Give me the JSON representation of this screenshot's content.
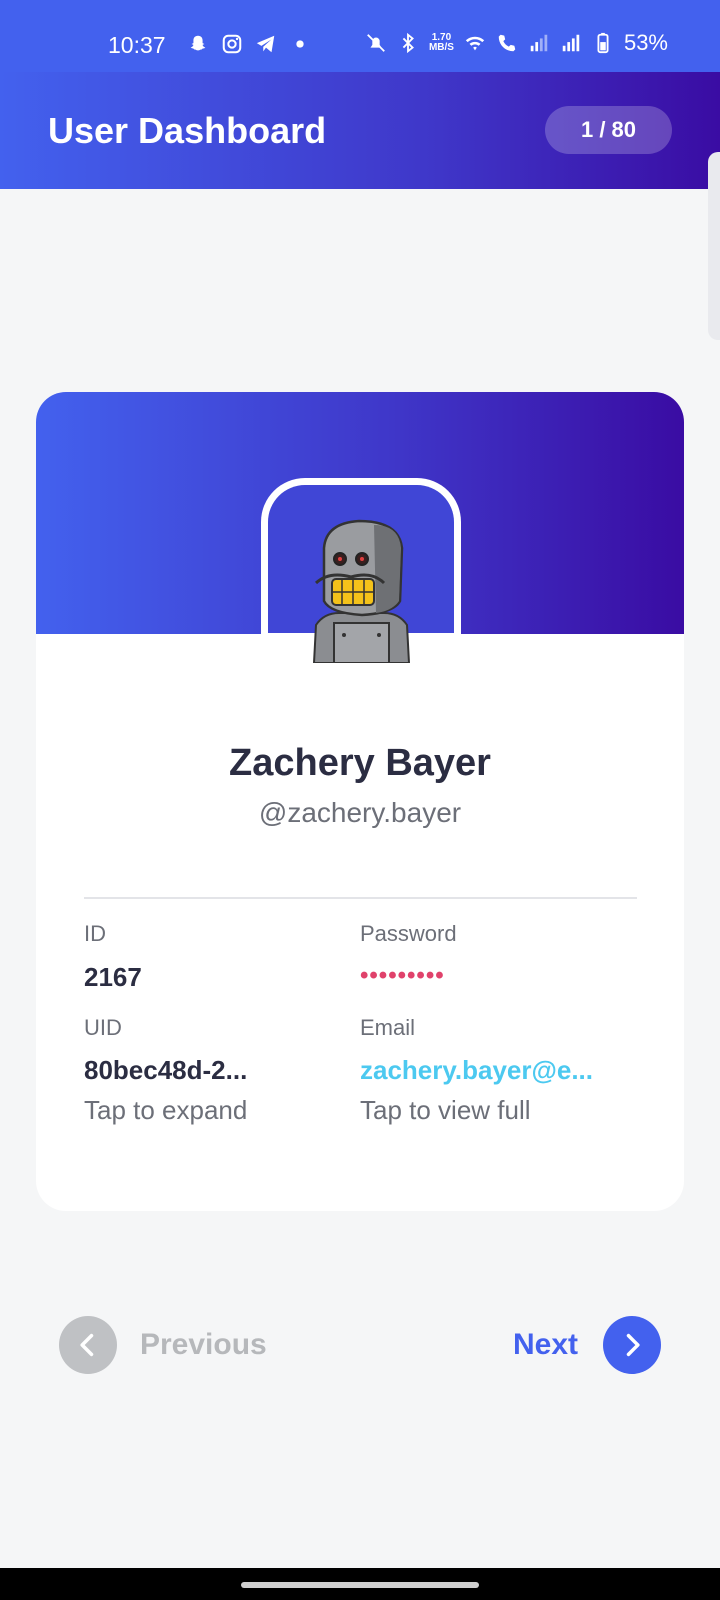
{
  "status_bar": {
    "time": "10:37",
    "net_speed_top": "1.70",
    "net_speed_bottom": "MB/S",
    "battery": "53%",
    "left_icons": [
      "snapchat-icon",
      "instagram-icon",
      "telegram-icon",
      "dot-icon"
    ],
    "right_icons": [
      "mute-icon",
      "bluetooth-icon",
      "wifi-icon",
      "call-icon",
      "signal-icon",
      "signal-roaming-icon",
      "battery-icon"
    ]
  },
  "header": {
    "title": "User Dashboard",
    "page_indicator": "1 / 80"
  },
  "profile": {
    "name": "Zachery Bayer",
    "username": "@zachery.bayer",
    "avatar": "robot-avatar"
  },
  "fields": {
    "id_label": "ID",
    "id_value": "2167",
    "password_label": "Password",
    "password_value": "•••••••••",
    "uid_label": "UID",
    "uid_value": "80bec48d-2...",
    "uid_hint": "Tap to expand",
    "email_label": "Email",
    "email_value": "zachery.bayer@e...",
    "email_hint": "Tap to view full"
  },
  "navigation": {
    "previous_label": "Previous",
    "next_label": "Next"
  },
  "colors": {
    "primary": "#4361ee",
    "gradient_end": "#3a0ca3",
    "password": "#e0426b",
    "email": "#4cc9f0",
    "disabled": "#bfc1c4"
  }
}
